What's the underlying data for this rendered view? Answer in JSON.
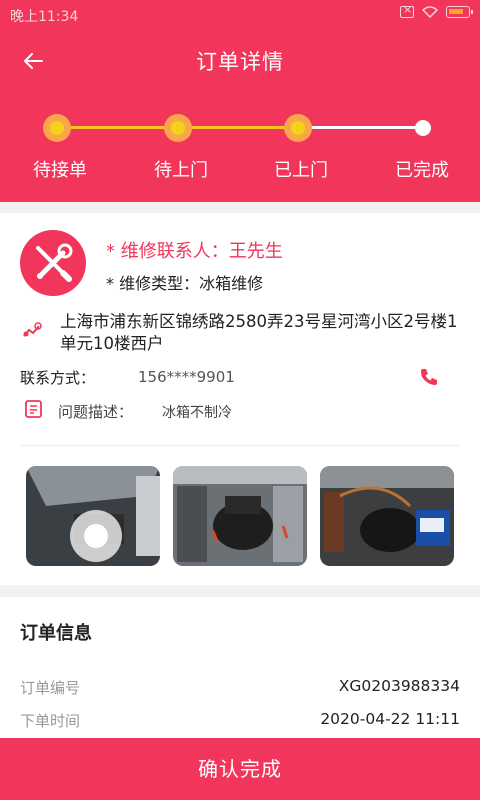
{
  "status_bar": {
    "time": "晚上11:34"
  },
  "header": {
    "title": "订单详情"
  },
  "progress": {
    "steps": [
      {
        "label": "待接单"
      },
      {
        "label": "待上门"
      },
      {
        "label": "已上门"
      },
      {
        "label": "已完成"
      }
    ]
  },
  "repair": {
    "contact": "* 维修联系人：王先生",
    "type": "* 维修类型：冰箱维修",
    "address": "上海市浦东新区锦绣路2580弄23号星河湾小区2号楼1单元10楼西户",
    "phone_label": "联系方式：",
    "phone_value": "156****9901",
    "desc_label": "问题描述：",
    "desc_value": "冰箱不制冷"
  },
  "order_info": {
    "title": "订单信息",
    "rows": [
      {
        "label": "订单编号",
        "value": "XG0203988334"
      },
      {
        "label": "下单时间",
        "value": "2020-04-22 11:11"
      }
    ]
  },
  "footer": {
    "confirm_label": "确认完成"
  },
  "colors": {
    "brand": "#f2355a",
    "progress_done": "#f5c820",
    "progress_dot": "#f9a54a"
  },
  "icons": [
    "back-arrow-icon",
    "wrench-screwdriver-icon",
    "location-route-icon",
    "phone-icon",
    "document-icon"
  ]
}
